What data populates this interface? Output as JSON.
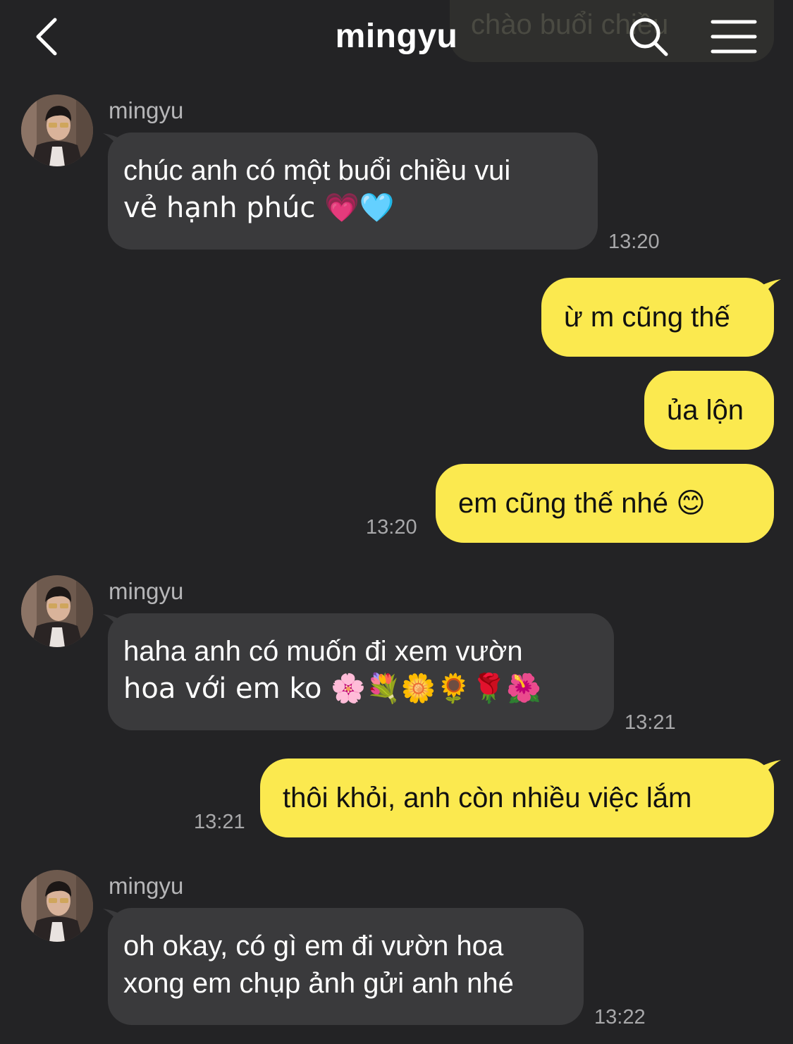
{
  "header": {
    "title": "mingyu",
    "peek_text": "chào buổi chiều",
    "back_icon": "chevron-left-icon",
    "search_icon": "search-icon",
    "menu_icon": "hamburger-menu-icon"
  },
  "colors": {
    "background": "#232325",
    "incoming_bubble": "#3a3a3c",
    "outgoing_bubble": "#fbe94f",
    "timestamp": "#a8a8aa"
  },
  "messages": [
    {
      "direction": "incoming",
      "sender": "mingyu",
      "line1": "chúc anh có một buổi chiều vui",
      "line2": "vẻ hạnh phúc 💗🩵",
      "time": "13:20"
    },
    {
      "direction": "outgoing",
      "text": "ừ m cũng thế"
    },
    {
      "direction": "outgoing",
      "text": "ủa lộn"
    },
    {
      "direction": "outgoing",
      "text": "em cũng thế nhé 😊",
      "time": "13:20"
    },
    {
      "direction": "incoming",
      "sender": "mingyu",
      "line1": "haha anh có muốn đi xem vườn",
      "line2": "hoa với em ko 🌸💐🌼🌻🌹🌺",
      "time": "13:21"
    },
    {
      "direction": "outgoing",
      "text": "thôi khỏi, anh còn nhiều việc lắm",
      "time": "13:21"
    },
    {
      "direction": "incoming",
      "sender": "mingyu",
      "line1": "oh okay, có gì em đi vườn hoa",
      "line2": "xong em chụp ảnh gửi anh nhé",
      "time": "13:22"
    }
  ]
}
